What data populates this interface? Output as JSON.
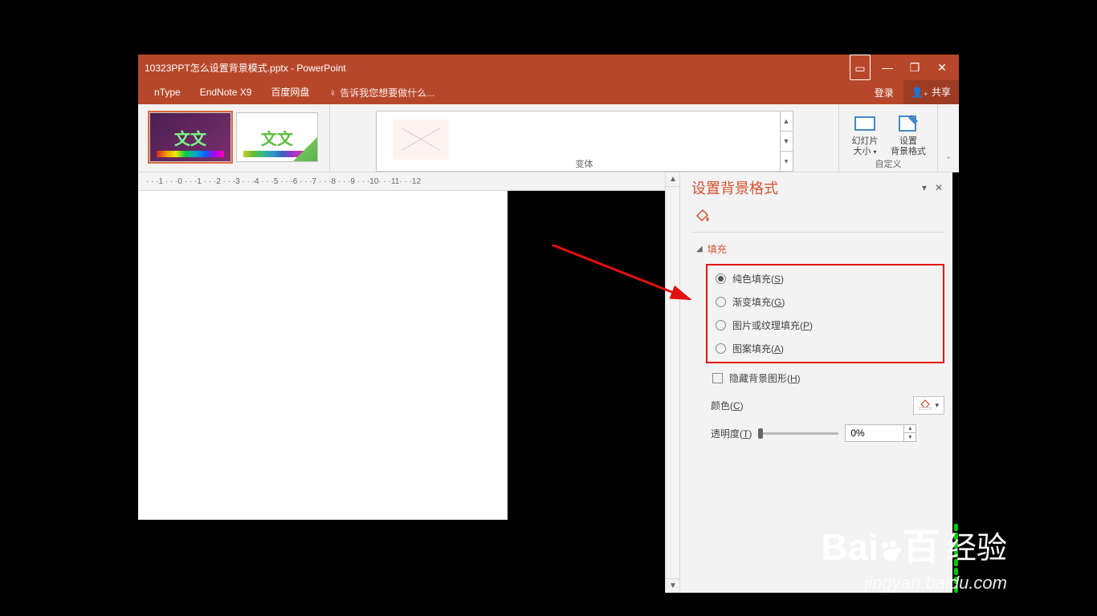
{
  "titlebar": {
    "title": "10323PPT怎么设置背景模式.pptx - PowerPoint"
  },
  "ribbon": {
    "tabs": {
      "ntype": "nType",
      "endnote": "EndNote X9",
      "baidu_net": "百度网盘"
    },
    "tell_me_placeholder": "告诉我您想要做什么...",
    "login": "登录",
    "share": "共享",
    "themes_sample_text": "文文",
    "variants_group_label": "变体",
    "customize": {
      "slide_size_label": "幻灯片\n大小",
      "format_bg_label": "设置\n背景格式",
      "group_label": "自定义"
    }
  },
  "ruler_text": "· · ·1 · · ·0 · · ·1 · · ·2 · · ·3 · · ·4 · · ·5 · · ·6 · · ·7 · · ·8 · · ·9 · · ·10· · ·11· · ·12",
  "pane": {
    "title": "设置背景格式",
    "section_fill": "填充",
    "options": {
      "solid": "纯色填充(",
      "solid_u": "S",
      "solid_close": ")",
      "gradient": "渐变填充(",
      "gradient_u": "G",
      "gradient_close": ")",
      "picture": "图片或纹理填充(",
      "picture_u": "P",
      "picture_close": ")",
      "pattern": "图案填充(",
      "pattern_u": "A",
      "pattern_close": ")",
      "hide_graphics": "隐藏背景图形(",
      "hide_graphics_u": "H",
      "hide_graphics_close": ")"
    },
    "color_label": "颜色(",
    "color_u": "C",
    "color_close": ")",
    "transparency_label": "透明度(",
    "transparency_u": "T",
    "transparency_close": ")",
    "transparency_value": "0%"
  },
  "watermark": {
    "brand": "Baiづ",
    "suffix": "经验",
    "url": "jingyan.baidu.com"
  }
}
